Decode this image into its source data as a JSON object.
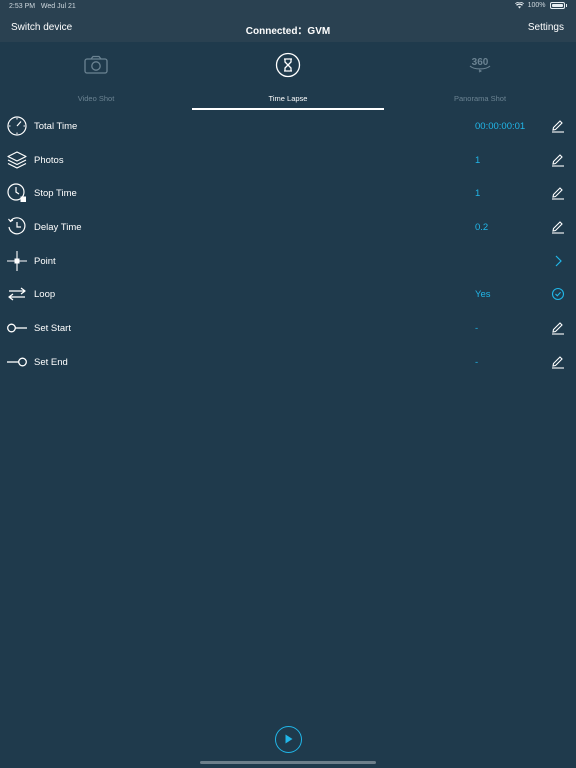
{
  "status_bar": {
    "time": "2:53 PM",
    "date": "Wed Jul 21",
    "battery": "100%"
  },
  "nav": {
    "left_label": "Switch device",
    "title": "Connected：GVM",
    "right_label": "Settings"
  },
  "modes": [
    {
      "label": "Video Shot",
      "icon": "camera-icon",
      "active": false
    },
    {
      "label": "Time Lapse",
      "icon": "hourglass-icon",
      "active": true
    },
    {
      "label": "Panorama Shot",
      "icon": "panorama-360-icon",
      "icon_text": "360",
      "active": false
    }
  ],
  "rows": [
    {
      "label": "Total Time",
      "value": "00:00:00:01",
      "icon": "stopwatch-icon",
      "action": "edit-icon"
    },
    {
      "label": "Photos",
      "value": "1",
      "icon": "layers-icon",
      "action": "edit-icon"
    },
    {
      "label": "Stop Time",
      "value": "1",
      "icon": "clock-stop-icon",
      "action": "edit-icon"
    },
    {
      "label": "Delay Time",
      "value": "0.2",
      "icon": "clock-delay-icon",
      "action": "edit-icon"
    },
    {
      "label": "Point",
      "value": "",
      "icon": "crosshair-point-icon",
      "action": "chevron-right-icon"
    },
    {
      "label": "Loop",
      "value": "Yes",
      "icon": "loop-arrows-icon",
      "action": "check-circle-icon"
    },
    {
      "label": "Set Start",
      "value": "-",
      "icon": "set-start-icon",
      "action": "edit-icon"
    },
    {
      "label": "Set End",
      "value": "-",
      "icon": "set-end-icon",
      "action": "edit-icon"
    }
  ],
  "colors": {
    "background": "#1f3a4c",
    "bar": "#2a4151",
    "accent": "#21b6e8",
    "inactive": "#6b8392"
  }
}
